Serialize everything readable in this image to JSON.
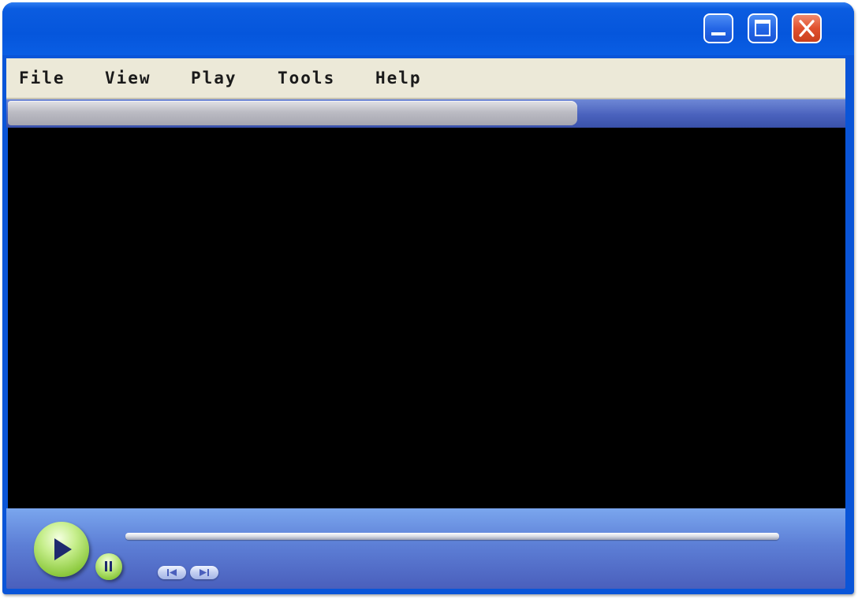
{
  "window": {
    "controls": {
      "minimize_icon": "minimize-icon",
      "maximize_icon": "maximize-icon",
      "close_icon": "close-icon"
    }
  },
  "menu": {
    "items": [
      {
        "label": "File"
      },
      {
        "label": "View"
      },
      {
        "label": "Play"
      },
      {
        "label": "Tools"
      },
      {
        "label": "Help"
      }
    ]
  },
  "player": {
    "play_icon": "play-icon",
    "pause_icon": "pause-icon",
    "previous_icon": "previous-track-icon",
    "next_icon": "next-track-icon"
  },
  "colors": {
    "title_bar": "#0556dc",
    "menu_bar": "#ece9d8",
    "video_area": "#000000",
    "control_panel": "#5d7fd6",
    "play_button": "#8cc93e",
    "close_button": "#e0502e"
  }
}
